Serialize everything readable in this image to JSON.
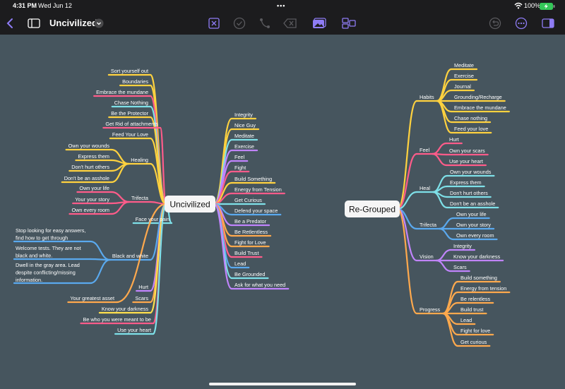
{
  "status": {
    "time": "4:31 PM",
    "date": "Wed Jun 12",
    "battery": "100%"
  },
  "toolbar": {
    "title": "Uncivilized"
  },
  "colors": {
    "accent": "#8e7cf5"
  },
  "left_map": {
    "root": "Uncivilized",
    "left": [
      {
        "text": "Sort yourself out",
        "color": "#ffd23f"
      },
      {
        "text": "Boundaries",
        "color": "#ffd23f"
      },
      {
        "text": "Embrace the mundane",
        "color": "#ff5c8a"
      },
      {
        "text": "Chase Nothing",
        "color": "#7ee0e8"
      },
      {
        "text": "Be the Protector",
        "color": "#ffd23f"
      },
      {
        "text": "Get Rid of attachments",
        "color": "#ff5c8a"
      },
      {
        "text": "Feed Your Love",
        "color": "#ffd23f"
      },
      {
        "text": "Healing",
        "color": "#ffd23f",
        "children": [
          {
            "text": "Own your wounds"
          },
          {
            "text": "Express them"
          },
          {
            "text": "Don't hurt others"
          },
          {
            "text": "Don't be an asshole"
          }
        ]
      },
      {
        "text": "Trifecta",
        "color": "#ff5c8a",
        "children": [
          {
            "text": "Own your life"
          },
          {
            "text": "Your your story"
          },
          {
            "text": "Own every room"
          }
        ]
      },
      {
        "text": "Face your pain",
        "color": "#7ee0e8"
      },
      {
        "text": "Black and white",
        "color": "#5aa9ee",
        "children": [
          {
            "text": "Stop looking for easy answers, find how to get through"
          },
          {
            "text": "Welcome tests. They are not black and white."
          },
          {
            "text": "Dwell in the gray area. Lead despite conflicting/missing information."
          }
        ]
      },
      {
        "text": "Hurt",
        "color": "#c084fc"
      },
      {
        "text": "Scars",
        "color": "#ffa94d"
      },
      {
        "text": "Your greatest asset",
        "color": "#ffa94d"
      },
      {
        "text": "Know your darkness",
        "color": "#ffe14d"
      },
      {
        "text": "Be who you were meant to be",
        "color": "#ff5c8a"
      },
      {
        "text": "Use your heart",
        "color": "#7ee0e8"
      }
    ],
    "right": [
      {
        "text": "Integrity",
        "color": "#ffd23f"
      },
      {
        "text": "Nice Guy",
        "color": "#ffd23f"
      },
      {
        "text": "Meditate",
        "color": "#7ee0e8"
      },
      {
        "text": "Exercise",
        "color": "#c084fc"
      },
      {
        "text": "Feel",
        "color": "#c084fc"
      },
      {
        "text": "Fight",
        "color": "#ff5c8a"
      },
      {
        "text": "Build Something",
        "color": "#ffd23f"
      },
      {
        "text": "Energy from Tension",
        "color": "#ff5c8a"
      },
      {
        "text": "Get Curious",
        "color": "#7ee0e8"
      },
      {
        "text": "Defend your space",
        "color": "#5aa9ee"
      },
      {
        "text": "Be a Predator",
        "color": "#c084fc"
      },
      {
        "text": "Be Retlentless",
        "color": "#ffa94d"
      },
      {
        "text": "Fight for Love",
        "color": "#ffa94d"
      },
      {
        "text": "Build Trust",
        "color": "#ff5c8a"
      },
      {
        "text": "Lead",
        "color": "#5aa9ee"
      },
      {
        "text": "Be Grounded",
        "color": "#7ee0e8"
      },
      {
        "text": "Ask for what you need",
        "color": "#c084fc"
      }
    ]
  },
  "right_map": {
    "root": "Re-Grouped",
    "groups": [
      {
        "text": "Habits",
        "color": "#ffd23f",
        "children": [
          "Meditate",
          "Exercise",
          "Journal",
          "Grounding/Recharge",
          "Embrace the mundane",
          "Chase nothing",
          "Feed your love"
        ]
      },
      {
        "text": "Feel",
        "color": "#ff5c8a",
        "children": [
          "Hurt",
          "Own your scars",
          "Use your heart"
        ]
      },
      {
        "text": "Heal",
        "color": "#7ee0e8",
        "children": [
          "Own your wounds",
          "Express them",
          "Don't hurt others",
          "Don't be an asshole"
        ]
      },
      {
        "text": "Trifecta",
        "color": "#5aa9ee",
        "children": [
          "Own your life",
          "Own your story",
          "Own every room"
        ]
      },
      {
        "text": "Vision",
        "color": "#c084fc",
        "children": [
          "Integrity",
          "Know your darkness",
          "Scars"
        ]
      },
      {
        "text": "Progress",
        "color": "#ffa94d",
        "children": [
          "Build something",
          "Energy from tension",
          "Be relentless",
          "Build trust",
          "Lead",
          "Fight for love",
          "Get curious"
        ]
      }
    ]
  }
}
